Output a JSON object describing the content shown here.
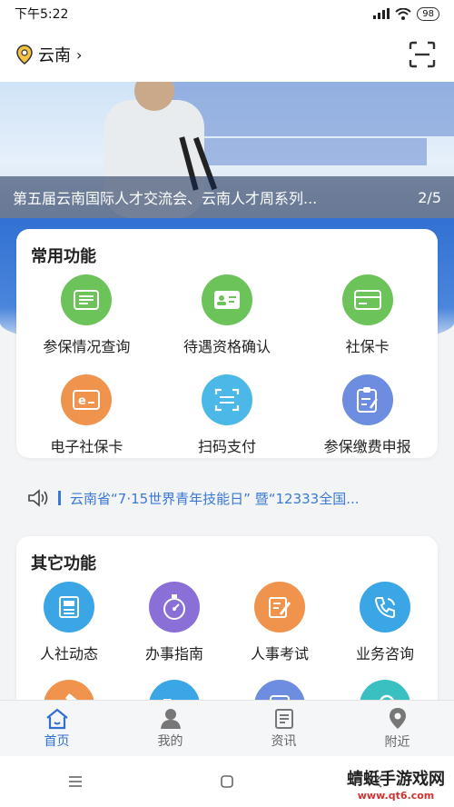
{
  "status_bar": {
    "time": "下午5:22",
    "battery": "98"
  },
  "header": {
    "location": "云南",
    "location_icon": "location-pin-icon",
    "scan_icon": "scan-icon"
  },
  "banner": {
    "caption": "第五届云南国际人才交流会、云南人才周系列...",
    "pager": "2/5"
  },
  "common_functions": {
    "title": "常用功能",
    "items": [
      {
        "label": "参保情况查询",
        "color": "#6cc35a",
        "icon": "document-list-icon"
      },
      {
        "label": "待遇资格确认",
        "color": "#6cc35a",
        "icon": "id-card-check-icon"
      },
      {
        "label": "社保卡",
        "color": "#6cc35a",
        "icon": "card-icon"
      },
      {
        "label": "电子社保卡",
        "color": "#f0934d",
        "icon": "e-card-icon"
      },
      {
        "label": "扫码支付",
        "color": "#4cb8e8",
        "icon": "scan-pay-icon"
      },
      {
        "label": "参保缴费申报",
        "color": "#6d8ee0",
        "icon": "clipboard-edit-icon"
      }
    ]
  },
  "notice": {
    "icon": "speaker-icon",
    "text": "云南省“7·15世界青年技能日” 暨“12333全国..."
  },
  "other_functions": {
    "title": "其它功能",
    "items": [
      {
        "label": "人社动态",
        "color": "#3aa6e6",
        "icon": "news-icon"
      },
      {
        "label": "办事指南",
        "color": "#8a70d6",
        "icon": "compass-icon"
      },
      {
        "label": "人事考试",
        "color": "#f0934d",
        "icon": "exam-edit-icon"
      },
      {
        "label": "业务咨询",
        "color": "#3aa6e6",
        "icon": "phone-icon"
      },
      {
        "label": "",
        "color": "#f0934d",
        "icon": "hammer-icon"
      },
      {
        "label": "",
        "color": "#3aa6e6",
        "icon": "folder-icon"
      },
      {
        "label": "",
        "color": "#6d8ee0",
        "icon": "hire-icon"
      },
      {
        "label": "",
        "color": "#3ac0c0",
        "icon": "search-icon"
      }
    ]
  },
  "tabbar": {
    "tabs": [
      {
        "label": "首页",
        "icon": "home-icon",
        "active": true
      },
      {
        "label": "我的",
        "icon": "user-icon",
        "active": false
      },
      {
        "label": "资讯",
        "icon": "news-tab-icon",
        "active": false
      },
      {
        "label": "附近",
        "icon": "location-tab-icon",
        "active": false
      }
    ]
  },
  "watermark": {
    "main": "蜻蜓手游戏网",
    "url": "www.qt6.com"
  }
}
